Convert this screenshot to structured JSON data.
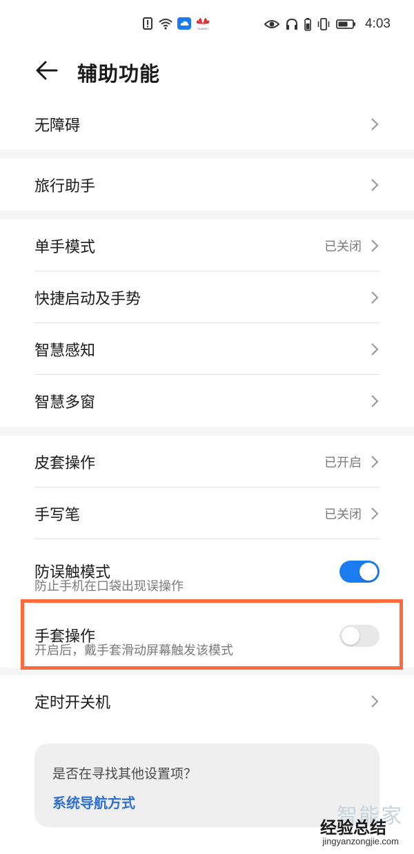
{
  "status_bar": {
    "time": "4:03",
    "left_icons": [
      "alert-icon",
      "wifi-icon",
      "cloud-icon",
      "huawei-logo-icon"
    ],
    "right_icons": [
      "eye-icon",
      "headphones-icon",
      "battery-saver-icon",
      "vibrate-icon",
      "battery-icon"
    ],
    "brand_text": "HUAWEI"
  },
  "header": {
    "title": "辅助功能",
    "back_icon": "back-arrow-icon"
  },
  "groups": [
    {
      "items": [
        {
          "label": "无障碍"
        }
      ]
    },
    {
      "items": [
        {
          "label": "旅行助手"
        }
      ]
    },
    {
      "items": [
        {
          "label": "单手模式",
          "status": "已关闭"
        },
        {
          "label": "快捷启动及手势"
        },
        {
          "label": "智慧感知"
        },
        {
          "label": "智慧多窗"
        }
      ]
    },
    {
      "items": [
        {
          "label": "皮套操作",
          "status": "已开启"
        },
        {
          "label": "手写笔",
          "status": "已关闭"
        },
        {
          "label": "防误触模式",
          "sub": "防止手机在口袋出现误操作",
          "toggle": true
        },
        {
          "label": "手套操作",
          "sub": "开启后，戴手套滑动屏幕触发该模式",
          "toggle": false
        }
      ]
    },
    {
      "items": [
        {
          "label": "定时开关机"
        }
      ]
    }
  ],
  "suggest": {
    "question": "是否在寻找其他设置项？",
    "link": "系统导航方式"
  },
  "watermark": {
    "top": "智能家",
    "mid": "经验总结",
    "bottom": "jingyanzongjie.com"
  },
  "colors": {
    "accent": "#1a7cf0",
    "highlight": "#ff6b3d",
    "link": "#2e6fd6"
  }
}
